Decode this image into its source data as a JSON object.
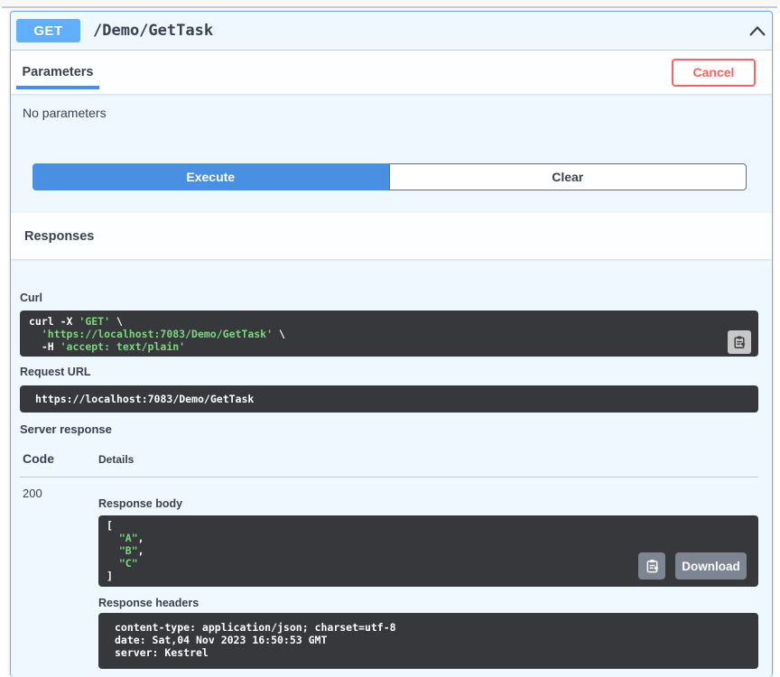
{
  "endpoint": {
    "method": "GET",
    "path": "/Demo/GetTask"
  },
  "parameters_section": {
    "tab_label": "Parameters",
    "cancel_label": "Cancel",
    "empty_text": "No parameters"
  },
  "actions": {
    "execute_label": "Execute",
    "clear_label": "Clear"
  },
  "responses": {
    "section_title": "Responses",
    "curl": {
      "label": "Curl",
      "lines": [
        {
          "white1": "curl -X ",
          "green": "'GET'",
          "white2": " \\"
        },
        {
          "white1": "  ",
          "green": "'https://localhost:7083/Demo/GetTask'",
          "white2": " \\"
        },
        {
          "white1": "  -H ",
          "green": "'accept: text/plain'",
          "white2": ""
        }
      ]
    },
    "request_url": {
      "label": "Request URL",
      "value": "https://localhost:7083/Demo/GetTask"
    },
    "server_response": {
      "label": "Server response",
      "code_header": "Code",
      "details_header": "Details",
      "row": {
        "code": "200",
        "body_label": "Response body",
        "body_lines": [
          {
            "white1": "[",
            "green": "",
            "white2": ""
          },
          {
            "white1": "  ",
            "green": "\"A\"",
            "white2": ","
          },
          {
            "white1": "  ",
            "green": "\"B\"",
            "white2": ","
          },
          {
            "white1": "  ",
            "green": "\"C\"",
            "white2": ""
          },
          {
            "white1": "]",
            "green": "",
            "white2": ""
          }
        ],
        "download_label": "Download",
        "headers_label": "Response headers",
        "headers_lines": [
          "content-type: application/json; charset=utf-8",
          "date: Sat,04 Nov 2023 16:50:53 GMT",
          "server: Kestrel"
        ]
      }
    }
  },
  "colors": {
    "method_get": "#61affe",
    "execute_blue": "#4990e2",
    "cancel_red": "#ff6060",
    "code_block_bg": "#36383c",
    "code_string_green": "#7ed57e",
    "opblock_bg": "#EFF7FF",
    "gray_button": "#7d8492"
  }
}
